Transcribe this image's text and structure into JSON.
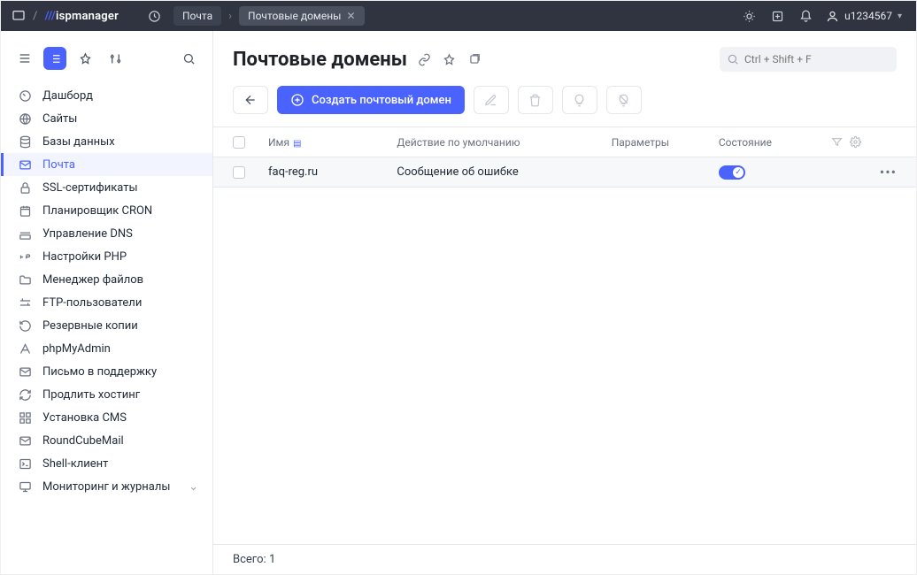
{
  "brand": {
    "prefix": "/",
    "mark": "///",
    "name": "ispmanager"
  },
  "breadcrumbs": {
    "first": "Почта",
    "second": "Почтовые домены"
  },
  "user": {
    "name": "u1234567"
  },
  "sidebar": {
    "items": [
      {
        "icon": "gauge",
        "label": "Дашборд"
      },
      {
        "icon": "globe",
        "label": "Сайты"
      },
      {
        "icon": "db",
        "label": "Базы данных"
      },
      {
        "icon": "mail",
        "label": "Почта",
        "active": true
      },
      {
        "icon": "lock",
        "label": "SSL-сертификаты"
      },
      {
        "icon": "calendar",
        "label": "Планировщик CRON"
      },
      {
        "icon": "dns",
        "label": "Управление DNS"
      },
      {
        "icon": "php",
        "label": "Настройки PHP"
      },
      {
        "icon": "folder",
        "label": "Менеджер файлов"
      },
      {
        "icon": "ftp",
        "label": "FTP-пользователи"
      },
      {
        "icon": "backup",
        "label": "Резервные копии"
      },
      {
        "icon": "pma",
        "label": "phpMyAdmin"
      },
      {
        "icon": "support",
        "label": "Письмо в поддержку"
      },
      {
        "icon": "refresh",
        "label": "Продлить хостинг"
      },
      {
        "icon": "grid",
        "label": "Установка CMS"
      },
      {
        "icon": "mail2",
        "label": "RoundCubeMail"
      },
      {
        "icon": "terminal",
        "label": "Shell-клиент"
      },
      {
        "icon": "monitor",
        "label": "Мониторинг и журналы",
        "chevron": true
      }
    ]
  },
  "page": {
    "title": "Почтовые домены",
    "search_placeholder": "Ctrl + Shift + F",
    "create_label": "Создать почтовый домен"
  },
  "table": {
    "cols": {
      "name": "Имя",
      "action": "Действие по умолчанию",
      "params": "Параметры",
      "state": "Состояние"
    },
    "rows": [
      {
        "name": "faq-reg.ru",
        "action": "Сообщение об ошибке",
        "state": true
      }
    ],
    "footer_label": "Всего:",
    "footer_count": "1"
  }
}
